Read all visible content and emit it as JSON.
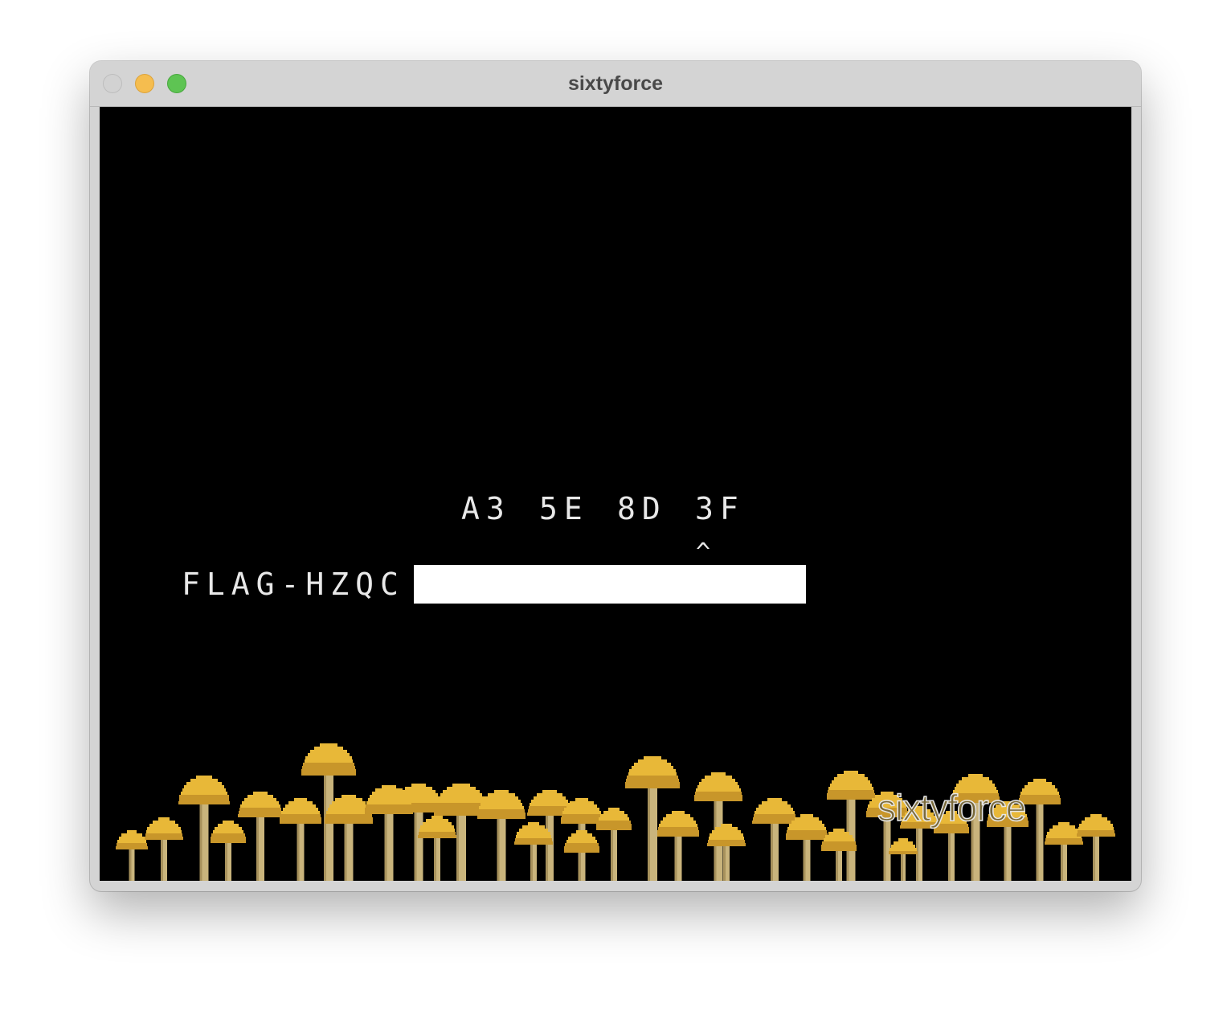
{
  "window": {
    "title": "sixtyforce"
  },
  "game": {
    "hex_bytes": [
      "A3",
      "5E",
      "8D",
      "3F"
    ],
    "cursor_marker": "^",
    "flag_label": "FLAG-HZQC",
    "flag_input_value": "",
    "watermark": "sixtyforce"
  },
  "colors": {
    "screen_bg": "#000000",
    "text": "#e8e8e8",
    "mushroom_cap": "#e8b838",
    "mushroom_cap_shade": "#c8962a",
    "mushroom_stem": "#c9b47c"
  },
  "icons": {
    "close": "close-traffic-light-icon",
    "minimize": "minimize-traffic-light-icon",
    "zoom": "zoom-traffic-light-icon"
  }
}
